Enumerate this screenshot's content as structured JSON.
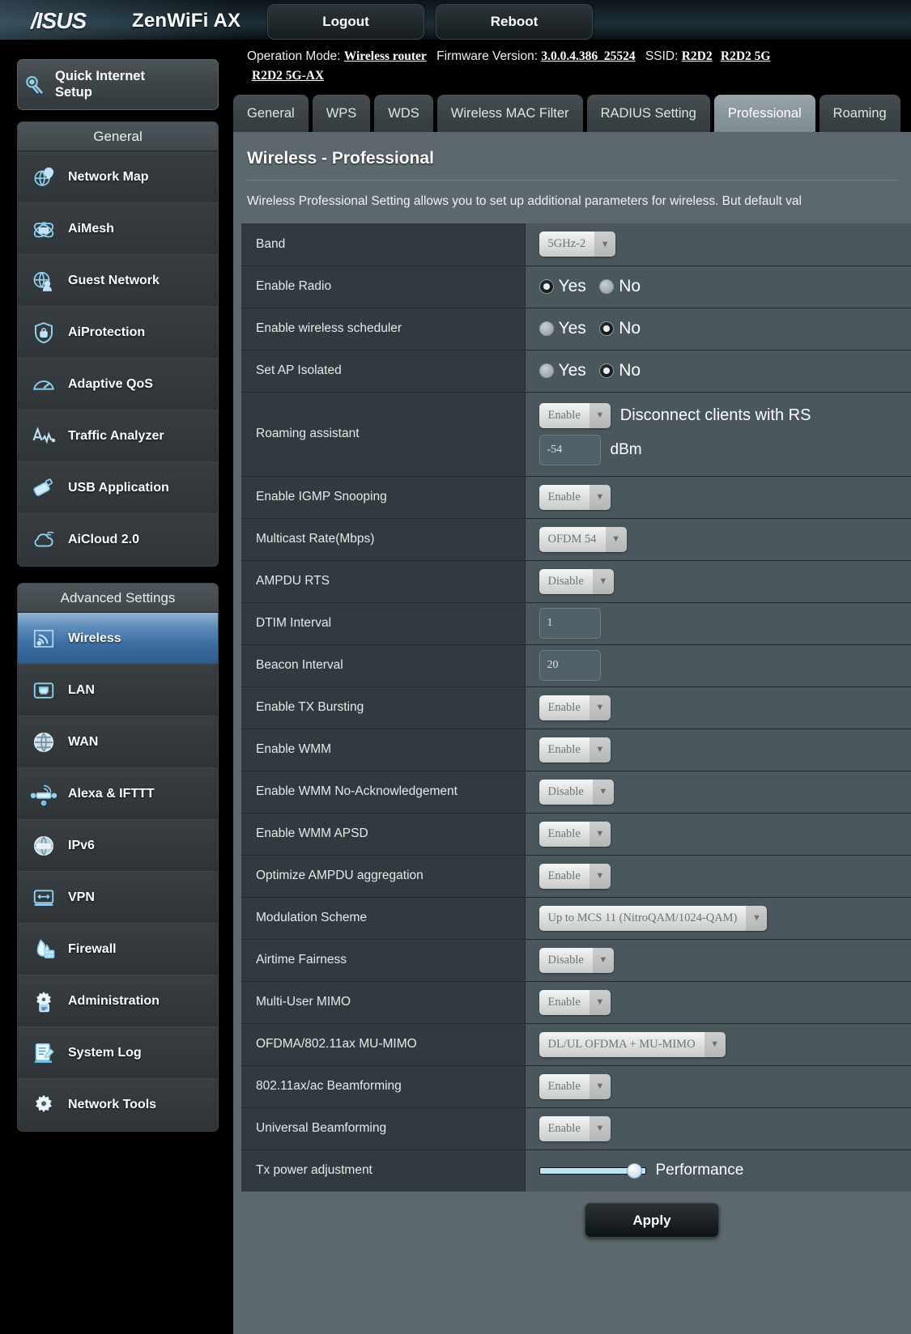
{
  "header": {
    "brand": "/ISUS",
    "model": "ZenWiFi AX",
    "logout_label": "Logout",
    "reboot_label": "Reboot"
  },
  "info": {
    "operation_mode_label": "Operation Mode:",
    "operation_mode_value": "Wireless router",
    "firmware_label": "Firmware Version:",
    "firmware_value": "3.0.0.4.386_25524",
    "ssid_label": "SSID:",
    "ssid_values": [
      "R2D2",
      "R2D2 5G",
      "R2D2 5G-AX"
    ]
  },
  "sidebar": {
    "quick_internet_setup": "Quick Internet\nSetup",
    "groups": [
      {
        "title": "General",
        "items": [
          {
            "label": "Network Map",
            "icon": "network-map-icon",
            "active": false
          },
          {
            "label": "AiMesh",
            "icon": "aimesh-icon",
            "active": false
          },
          {
            "label": "Guest Network",
            "icon": "guest-network-icon",
            "active": false
          },
          {
            "label": "AiProtection",
            "icon": "aiprotection-shield-icon",
            "active": false
          },
          {
            "label": "Adaptive QoS",
            "icon": "adaptive-qos-gauge-icon",
            "active": false
          },
          {
            "label": "Traffic Analyzer",
            "icon": "traffic-analyzer-icon",
            "active": false
          },
          {
            "label": "USB Application",
            "icon": "usb-application-icon",
            "active": false
          },
          {
            "label": "AiCloud 2.0",
            "icon": "aicloud-icon",
            "active": false
          }
        ]
      },
      {
        "title": "Advanced Settings",
        "items": [
          {
            "label": "Wireless",
            "icon": "wireless-signal-icon",
            "active": true
          },
          {
            "label": "LAN",
            "icon": "lan-port-icon",
            "active": false
          },
          {
            "label": "WAN",
            "icon": "wan-globe-icon",
            "active": false
          },
          {
            "label": "Alexa & IFTTT",
            "icon": "alexa-ifttt-icon",
            "active": false
          },
          {
            "label": "IPv6",
            "icon": "ipv6-globe-icon",
            "active": false
          },
          {
            "label": "VPN",
            "icon": "vpn-monitor-icon",
            "active": false
          },
          {
            "label": "Firewall",
            "icon": "firewall-flame-icon",
            "active": false
          },
          {
            "label": "Administration",
            "icon": "administration-gear-icon",
            "active": false
          },
          {
            "label": "System Log",
            "icon": "system-log-icon",
            "active": false
          },
          {
            "label": "Network Tools",
            "icon": "network-tools-gear-icon",
            "active": false
          }
        ]
      }
    ]
  },
  "tabs": [
    {
      "label": "General",
      "active": false
    },
    {
      "label": "WPS",
      "active": false
    },
    {
      "label": "WDS",
      "active": false
    },
    {
      "label": "Wireless MAC Filter",
      "active": false
    },
    {
      "label": "RADIUS Setting",
      "active": false
    },
    {
      "label": "Professional",
      "active": true
    },
    {
      "label": "Roaming",
      "active": false
    }
  ],
  "panel": {
    "title": "Wireless - Professional",
    "description": "Wireless Professional Setting allows you to set up additional parameters for wireless. But default val",
    "apply_label": "Apply"
  },
  "settings": {
    "band": {
      "label": "Band",
      "value": "5GHz-2"
    },
    "enable_radio": {
      "label": "Enable Radio",
      "yes": "Yes",
      "no": "No",
      "selected": "Yes"
    },
    "enable_wireless_scheduler": {
      "label": "Enable wireless scheduler",
      "yes": "Yes",
      "no": "No",
      "selected": "No"
    },
    "set_ap_isolated": {
      "label": "Set AP Isolated",
      "yes": "Yes",
      "no": "No",
      "selected": "No"
    },
    "roaming_assistant": {
      "label": "Roaming assistant",
      "value": "Enable",
      "note": "Disconnect clients with RS",
      "rssi": "-54",
      "unit": "dBm"
    },
    "enable_igmp_snooping": {
      "label": "Enable IGMP Snooping",
      "value": "Enable"
    },
    "multicast_rate": {
      "label": "Multicast Rate(Mbps)",
      "value": "OFDM 54"
    },
    "ampdu_rts": {
      "label": "AMPDU RTS",
      "value": "Disable"
    },
    "dtim_interval": {
      "label": "DTIM Interval",
      "value": "1"
    },
    "beacon_interval": {
      "label": "Beacon Interval",
      "value": "20"
    },
    "enable_tx_bursting": {
      "label": "Enable TX Bursting",
      "value": "Enable"
    },
    "enable_wmm": {
      "label": "Enable WMM",
      "value": "Enable"
    },
    "enable_wmm_no_ack": {
      "label": "Enable WMM No-Acknowledgement",
      "value": "Disable"
    },
    "enable_wmm_apsd": {
      "label": "Enable WMM APSD",
      "value": "Enable"
    },
    "optimize_ampdu": {
      "label": "Optimize AMPDU aggregation",
      "value": "Enable"
    },
    "modulation_scheme": {
      "label": "Modulation Scheme",
      "value": "Up to MCS 11 (NitroQAM/1024-QAM)"
    },
    "airtime_fairness": {
      "label": "Airtime Fairness",
      "value": "Disable"
    },
    "mu_mimo": {
      "label": "Multi-User MIMO",
      "value": "Enable"
    },
    "ofdma_mu_mimo": {
      "label": "OFDMA/802.11ax MU-MIMO",
      "value": "DL/UL OFDMA + MU-MIMO"
    },
    "beamforming_ax_ac": {
      "label": "802.11ax/ac Beamforming",
      "value": "Enable"
    },
    "universal_beamforming": {
      "label": "Universal Beamforming",
      "value": "Enable"
    },
    "tx_power": {
      "label": "Tx power adjustment",
      "mode": "Performance",
      "percent": 86
    }
  },
  "colors": {
    "accent_blue": "#3c6fa3",
    "panel_bg": "#5c686d",
    "row_label_bg": "#313b3f",
    "row_value_bg": "#4a575c",
    "slider_fill": "#bfe4fa"
  }
}
